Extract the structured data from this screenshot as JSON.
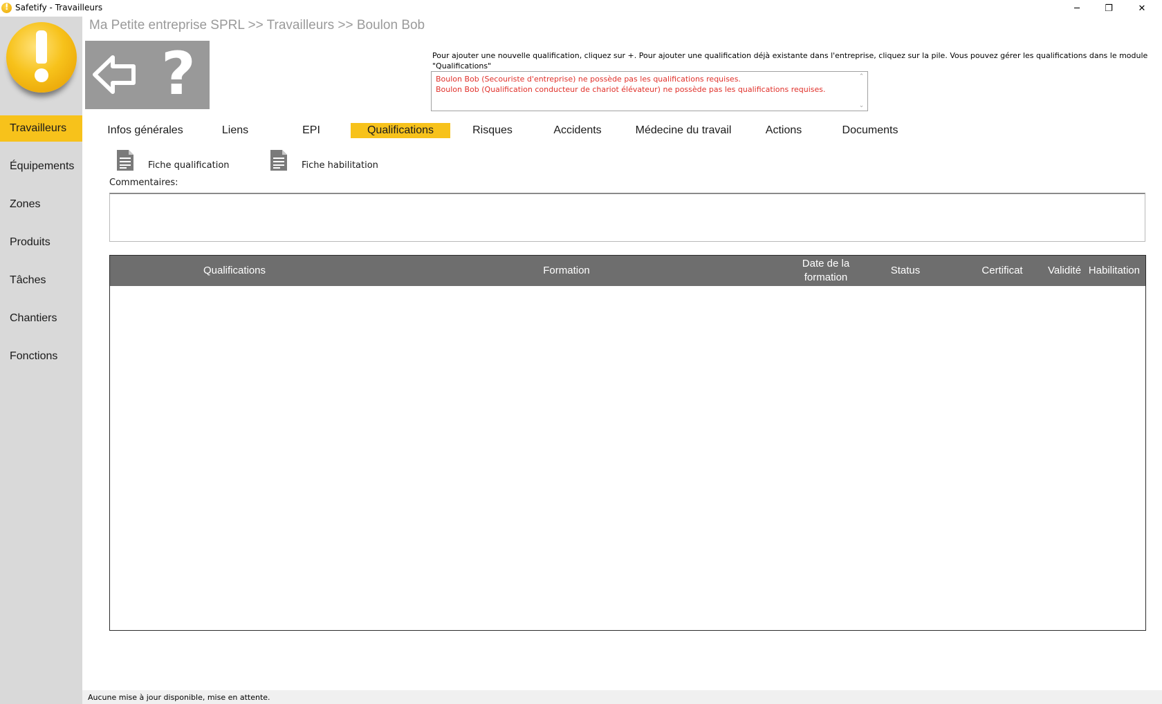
{
  "window": {
    "title": "Safetify - Travailleurs",
    "controls": {
      "minimize": "─",
      "restore": "❐",
      "close": "✕"
    }
  },
  "sidebar": {
    "items": [
      {
        "label": "Travailleurs",
        "active": true
      },
      {
        "label": "Équipements",
        "active": false
      },
      {
        "label": "Zones",
        "active": false
      },
      {
        "label": "Produits",
        "active": false
      },
      {
        "label": "Tâches",
        "active": false
      },
      {
        "label": "Chantiers",
        "active": false
      },
      {
        "label": "Fonctions",
        "active": false
      }
    ]
  },
  "header": {
    "breadcrumb": "Ma Petite entreprise SPRL >> Travailleurs >> Boulon Bob",
    "help_glyph": "?"
  },
  "info": {
    "text": "Pour ajouter une nouvelle qualification, cliquez sur +. Pour ajouter une qualification déjà existante dans l'entreprise, cliquez sur la pile. Vous pouvez gérer les qualifications dans le module \"Qualifications\"",
    "warnings": [
      "Boulon Bob (Secouriste d'entreprise) ne possède pas les qualifications requises.",
      "Boulon Bob (Qualification conducteur de chariot élévateur) ne possède pas les qualifications requises."
    ]
  },
  "tabs": [
    {
      "label": "Infos générales",
      "active": false
    },
    {
      "label": "Liens",
      "active": false
    },
    {
      "label": "EPI",
      "active": false
    },
    {
      "label": "Qualifications",
      "active": true
    },
    {
      "label": "Risques",
      "active": false
    },
    {
      "label": "Accidents",
      "active": false
    },
    {
      "label": "Médecine du travail",
      "active": false
    },
    {
      "label": "Actions",
      "active": false
    },
    {
      "label": "Documents",
      "active": false
    }
  ],
  "fiches": {
    "qualification": "Fiche qualification",
    "habilitation": "Fiche habilitation"
  },
  "comments": {
    "label": "Commentaires:",
    "value": ""
  },
  "grid": {
    "columns": [
      "Qualifications",
      "Formation",
      "Date de la formation",
      "Status",
      "Certificat",
      "Validité",
      "Habilitation"
    ],
    "rows": []
  },
  "status": {
    "text": "Aucune mise à jour disponible, mise en attente."
  },
  "colors": {
    "accent": "#f7c21b",
    "sidebar_bg": "#d9d9d9",
    "nav_box": "#999999",
    "grid_header": "#6e6e6e",
    "warning_text": "#e0302a",
    "breadcrumb_text": "#9a9a9a"
  }
}
